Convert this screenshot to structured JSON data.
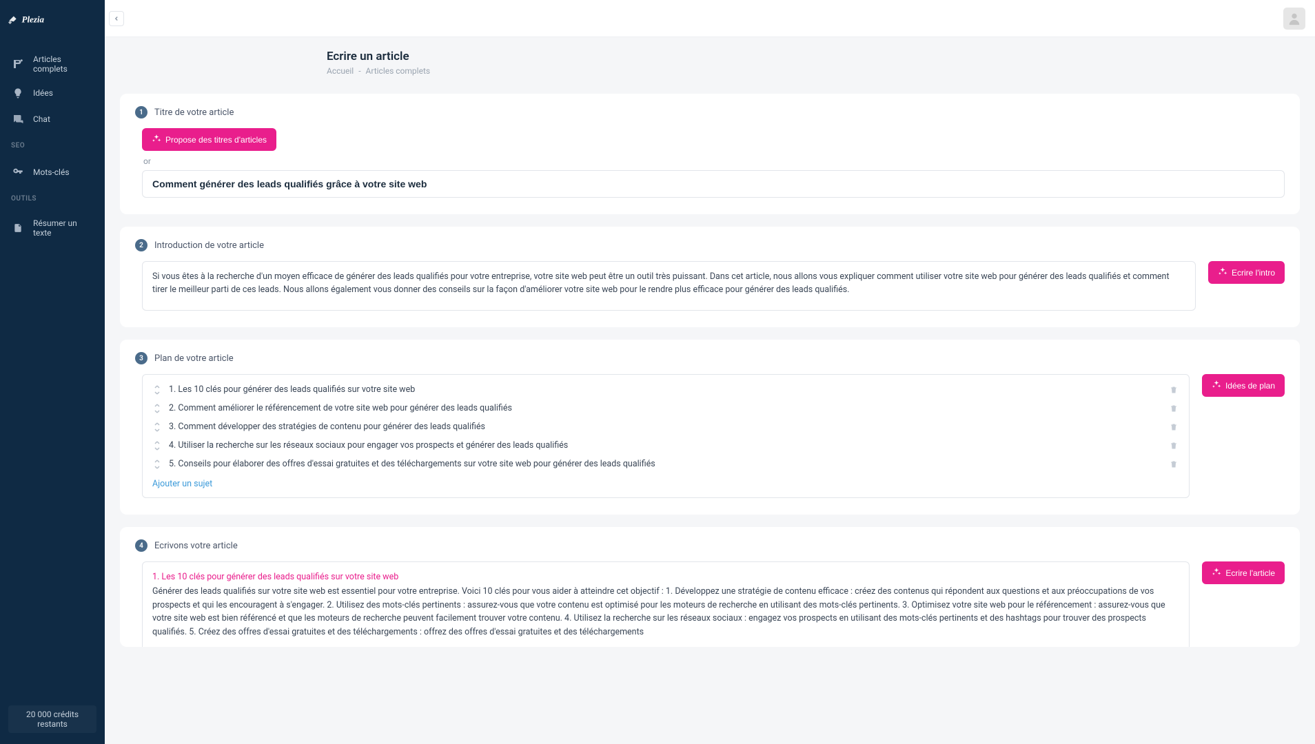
{
  "brand": "Plezia",
  "sidebar": {
    "items": [
      {
        "label": "Articles complets"
      },
      {
        "label": "Idées"
      },
      {
        "label": "Chat"
      }
    ],
    "seo_heading": "SEO",
    "seo_items": [
      {
        "label": "Mots-clés"
      }
    ],
    "tools_heading": "OUTILS",
    "tools_items": [
      {
        "label": "Résumer un texte"
      }
    ],
    "credits": "20 000 crédits restants"
  },
  "header": {
    "title": "Ecrire un article",
    "breadcrumb_home": "Accueil",
    "breadcrumb_current": "Articles complets"
  },
  "step1": {
    "num": "1",
    "label": "Titre de votre article",
    "propose_btn": "Propose des titres d'articles",
    "or": "or",
    "title_value": "Comment générer des leads qualifiés grâce à votre site web"
  },
  "step2": {
    "num": "2",
    "label": "Introduction de votre article",
    "intro_text": "Si vous êtes à la recherche d'un moyen efficace de générer des leads qualifiés pour votre entreprise, votre site web peut être un outil très puissant. Dans cet article, nous allons vous expliquer comment utiliser votre site web pour générer des leads qualifiés et comment tirer le meilleur parti de ces leads. Nous allons également vous donner des conseils sur la façon d'améliorer votre site web pour le rendre plus efficace pour générer des leads qualifiés.",
    "write_btn": "Ecrire l'intro"
  },
  "step3": {
    "num": "3",
    "label": "Plan de votre article",
    "items": [
      "1. Les 10 clés pour générer des leads qualifiés sur votre site web",
      "2. Comment améliorer le référencement de votre site web pour générer des leads qualifiés",
      "3. Comment développer des stratégies de contenu pour générer des leads qualifiés",
      "4. Utiliser la recherche sur les réseaux sociaux pour engager vos prospects et générer des leads qualifiés",
      "5. Conseils pour élaborer des offres d'essai gratuites et des téléchargements sur votre site web pour générer des leads qualifiés"
    ],
    "add_subject": "Ajouter un sujet",
    "ideas_btn": "Idées de plan"
  },
  "step4": {
    "num": "4",
    "label": "Ecrivons votre article",
    "heading": "1. Les 10 clés pour générer des leads qualifiés sur votre site web",
    "body": "Générer des leads qualifiés sur votre site web est essentiel pour votre entreprise. Voici 10 clés pour vous aider à atteindre cet objectif : 1. Développez une stratégie de contenu efficace : créez des contenus qui répondent aux questions et aux préoccupations de vos prospects et qui les encouragent à s'engager. 2. Utilisez des mots-clés pertinents : assurez-vous que votre contenu est optimisé pour les moteurs de recherche en utilisant des mots-clés pertinents. 3. Optimisez votre site web pour le référencement : assurez-vous que votre site web est bien référencé et que les moteurs de recherche peuvent facilement trouver votre contenu. 4. Utilisez la recherche sur les réseaux sociaux : engagez vos prospects en utilisant des mots-clés pertinents et des hashtags pour trouver des prospects qualifiés. 5. Créez des offres d'essai gratuites et des téléchargements : offrez des offres d'essai gratuites et des téléchargements",
    "write_btn": "Ecrire l'article"
  }
}
